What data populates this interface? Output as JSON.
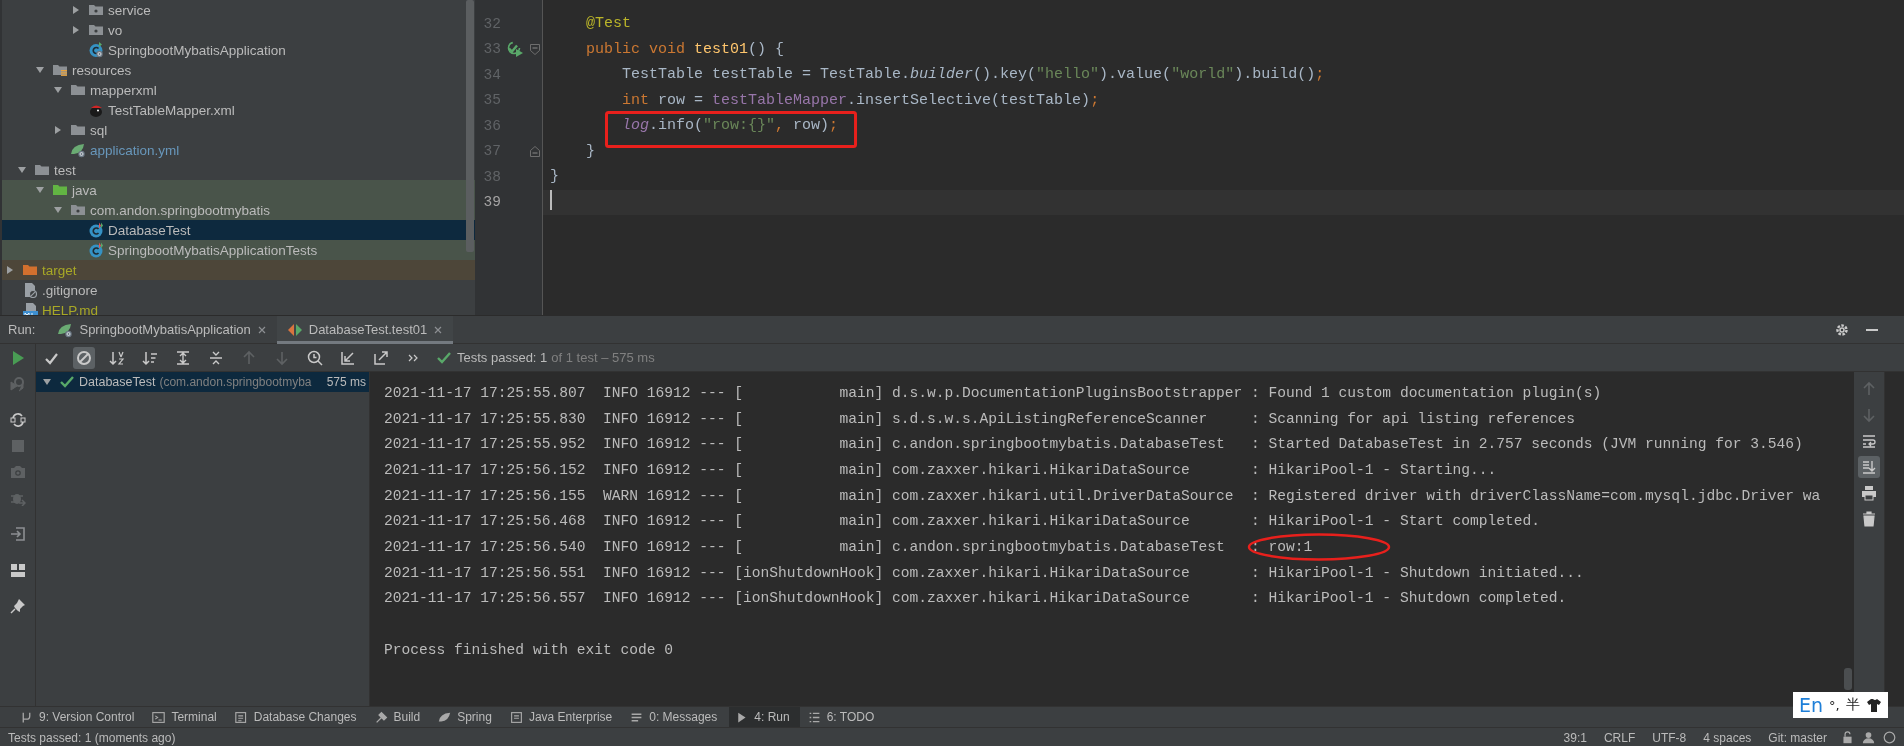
{
  "project_tree": [
    {
      "children": [
        {
          "children": [
            {
              "children": [
                {
                  "children": [
                    {
                      "label": "service",
                      "kind": "package",
                      "expanded": false,
                      "selected": false,
                      "modified": false,
                      "ignored": false
                    },
                    {
                      "label": "vo",
                      "kind": "package",
                      "expanded": false,
                      "selected": false,
                      "modified": false,
                      "ignored": false
                    },
                    {
                      "label": "SpringbootMybatisApplication",
                      "kind": "spring-class",
                      "selected": false,
                      "modified": false,
                      "ignored": false
                    }
                  ]
                }
              ]
            },
            {
              "label": "resources",
              "kind": "resources-root",
              "expanded": true,
              "selected": false,
              "modified": false,
              "ignored": false,
              "children": [
                {
                  "label": "mapperxml",
                  "kind": "folder",
                  "expanded": true,
                  "selected": false,
                  "modified": false,
                  "ignored": false,
                  "children": [
                    {
                      "label": "TestTableMapper.xml",
                      "kind": "mybatis-xml",
                      "selected": false,
                      "modified": false,
                      "ignored": false
                    }
                  ]
                },
                {
                  "label": "sql",
                  "kind": "folder",
                  "expanded": false,
                  "selected": false,
                  "modified": false,
                  "ignored": false
                },
                {
                  "label": "application.yml",
                  "kind": "spring-yml",
                  "selected": false,
                  "modified": true,
                  "ignored": false
                }
              ]
            }
          ]
        },
        {
          "label": "test",
          "kind": "folder",
          "expanded": true,
          "selected": false,
          "modified": false,
          "ignored": false,
          "children": [
            {
              "label": "java",
              "kind": "test-root",
              "expanded": true,
              "test_scope": true,
              "selected": false,
              "modified": false,
              "ignored": false,
              "children": [
                {
                  "label": "com.andon.springbootmybatis",
                  "kind": "package",
                  "expanded": true,
                  "test_scope": true,
                  "selected": false,
                  "modified": false,
                  "ignored": false,
                  "children": [
                    {
                      "label": "DatabaseTest",
                      "kind": "test-class",
                      "test_scope": true,
                      "selected": true,
                      "modified": false,
                      "ignored": false
                    },
                    {
                      "label": "SpringbootMybatisApplicationTests",
                      "kind": "test-class",
                      "test_scope": true,
                      "selected": false,
                      "modified": false,
                      "ignored": false
                    }
                  ]
                }
              ]
            }
          ]
        }
      ]
    },
    {
      "label": "target",
      "kind": "excluded-folder",
      "expanded": false,
      "excluded": true,
      "selected": false,
      "modified": false,
      "ignored": true
    },
    {
      "label": ".gitignore",
      "kind": "ignore-file",
      "selected": false,
      "modified": false,
      "ignored": false
    },
    {
      "label": "HELP.md",
      "kind": "markdown",
      "selected": false,
      "modified": false,
      "ignored": true
    }
  ],
  "editor": {
    "lines": [
      {
        "number": "32",
        "tokens": [
          {
            "t": "    @Test",
            "kind": "annotation"
          }
        ],
        "runnable": false,
        "fold_start": false,
        "fold_end": false,
        "current": false,
        "highlighted": false
      },
      {
        "number": "33",
        "tokens": [
          {
            "t": "    public void ",
            "kind": "keyword"
          },
          {
            "t": "test01",
            "kind": "method"
          },
          {
            "t": "() {",
            "kind": "plain"
          }
        ],
        "runnable": true,
        "fold_start": true,
        "fold_end": false,
        "current": false,
        "highlighted": false
      },
      {
        "number": "34",
        "tokens": [
          {
            "t": "        TestTable testTable = TestTable.",
            "kind": "plain"
          },
          {
            "t": "builder",
            "kind": "italic"
          },
          {
            "t": "().key(",
            "kind": "plain"
          },
          {
            "t": "\"hello\"",
            "kind": "string"
          },
          {
            "t": ").value(",
            "kind": "plain"
          },
          {
            "t": "\"world\"",
            "kind": "string"
          },
          {
            "t": ").build()",
            "kind": "plain"
          },
          {
            "t": ";",
            "kind": "keyword"
          }
        ],
        "runnable": false,
        "fold_start": false,
        "fold_end": false,
        "current": false,
        "highlighted": false
      },
      {
        "number": "35",
        "tokens": [
          {
            "t": "        int",
            "kind": "keyword"
          },
          {
            "t": " row = ",
            "kind": "plain"
          },
          {
            "t": "testTableMapper",
            "kind": "field"
          },
          {
            "t": ".insertSelective(testTable)",
            "kind": "plain"
          },
          {
            "t": ";",
            "kind": "keyword"
          }
        ],
        "runnable": false,
        "fold_start": false,
        "fold_end": false,
        "current": false,
        "highlighted": false
      },
      {
        "number": "36",
        "tokens": [
          {
            "t": "        log",
            "kind": "static"
          },
          {
            "t": ".info(",
            "kind": "plain"
          },
          {
            "t": "\"row:{}\"",
            "kind": "string"
          },
          {
            "t": ",",
            "kind": "keyword"
          },
          {
            "t": " row)",
            "kind": "plain"
          },
          {
            "t": ";",
            "kind": "keyword"
          }
        ],
        "runnable": false,
        "fold_start": false,
        "fold_end": false,
        "current": false,
        "highlighted": true
      },
      {
        "number": "37",
        "tokens": [
          {
            "t": "    }",
            "kind": "plain"
          }
        ],
        "runnable": false,
        "fold_start": false,
        "fold_end": true,
        "current": false,
        "highlighted": false
      },
      {
        "number": "38",
        "tokens": [
          {
            "t": "}",
            "kind": "plain"
          }
        ],
        "runnable": false,
        "fold_start": false,
        "fold_end": false,
        "current": false,
        "highlighted": false
      },
      {
        "number": "39",
        "runnable": false,
        "fold_start": false,
        "fold_end": false,
        "current": true,
        "highlighted": false
      }
    ]
  },
  "run_panel": {
    "label": "Run:",
    "tabs": [
      {
        "label": "SpringbootMybatisApplication",
        "selected": false
      },
      {
        "label": "DatabaseTest.test01",
        "selected": true
      }
    ],
    "toolbar": {
      "status": "Tests passed: 1",
      "detail": "of 1 test – 575 ms"
    },
    "test_tree": [
      {
        "label": "DatabaseTest",
        "detail": "(com.andon.springbootmyba",
        "duration": "575 ms",
        "expanded": true,
        "passed": true,
        "selected": true
      }
    ],
    "console": {
      "lines": [
        {
          "source": "2021-11-17 17:25:55.807  INFO 16912 --- [           main] d.s.w.p.DocumentationPluginsBootstrapper",
          "message": ": Found 1 custom documentation plugin(s)",
          "circled": false
        },
        {
          "source": "2021-11-17 17:25:55.830  INFO 16912 --- [           main] s.d.s.w.s.ApiListingReferenceScanner",
          "message": ": Scanning for api listing references",
          "circled": false
        },
        {
          "source": "2021-11-17 17:25:55.952  INFO 16912 --- [           main] c.andon.springbootmybatis.DatabaseTest",
          "message": ": Started DatabaseTest in 2.757 seconds (JVM running for 3.546)",
          "circled": false
        },
        {
          "source": "2021-11-17 17:25:56.152  INFO 16912 --- [           main] com.zaxxer.hikari.HikariDataSource",
          "message": ": HikariPool-1 - Starting...",
          "circled": false
        },
        {
          "source": "2021-11-17 17:25:56.155  WARN 16912 --- [           main] com.zaxxer.hikari.util.DriverDataSource",
          "message": ": Registered driver with driverClassName=com.mysql.jdbc.Driver wa",
          "circled": false
        },
        {
          "source": "2021-11-17 17:25:56.468  INFO 16912 --- [           main] com.zaxxer.hikari.HikariDataSource",
          "message": ": HikariPool-1 - Start completed.",
          "circled": false
        },
        {
          "source": "2021-11-17 17:25:56.540  INFO 16912 --- [           main] c.andon.springbootmybatis.DatabaseTest",
          "message": ": row:1",
          "circled": true
        },
        {
          "source": "2021-11-17 17:25:56.551  INFO 16912 --- [ionShutdownHook] com.zaxxer.hikari.HikariDataSource",
          "message": ": HikariPool-1 - Shutdown initiated...",
          "circled": false
        },
        {
          "source": "2021-11-17 17:25:56.557  INFO 16912 --- [ionShutdownHook] com.zaxxer.hikari.HikariDataSource",
          "message": ": HikariPool-1 - Shutdown completed.",
          "circled": false
        }
      ],
      "exit_message": "Process finished with exit code 0"
    }
  },
  "tool_windows": [
    {
      "label": "9: Version Control",
      "selected": false
    },
    {
      "label": "Terminal",
      "selected": false
    },
    {
      "label": "Database Changes",
      "selected": false
    },
    {
      "label": "Build",
      "selected": false
    },
    {
      "label": "Spring",
      "selected": false
    },
    {
      "label": "Java Enterprise",
      "selected": false
    },
    {
      "label": "0: Messages",
      "selected": false
    },
    {
      "label": "4: Run",
      "selected": true
    },
    {
      "label": "6: TODO",
      "selected": false
    }
  ],
  "status_bar": {
    "message": "Tests passed: 1 (moments ago)",
    "items": [
      "39:1",
      "CRLF",
      "UTF-8",
      "4 spaces",
      "Git: master"
    ]
  },
  "input_method": {
    "language": "En",
    "punctuation": "°,",
    "width_mode": "半"
  }
}
